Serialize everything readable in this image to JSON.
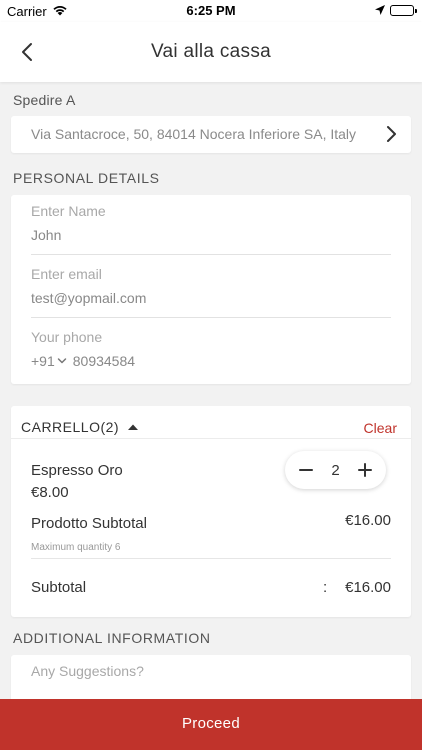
{
  "status_bar": {
    "carrier": "Carrier",
    "time": "6:25 PM",
    "icons": [
      "wifi-icon",
      "location-arrow-icon",
      "battery-icon"
    ]
  },
  "nav": {
    "title": "Vai alla cassa",
    "back_icon": "chevron-left-icon"
  },
  "shipping": {
    "label": "Spedire A",
    "address": "Via Santacroce, 50, 84014 Nocera Inferiore SA, Italy",
    "chevron_icon": "chevron-right-icon"
  },
  "personal": {
    "label": "PERSONAL DETAILS",
    "name": {
      "placeholder": "Enter Name",
      "value": "John"
    },
    "email": {
      "placeholder": "Enter email",
      "value": "test@yopmail.com"
    },
    "phone": {
      "placeholder": "Your phone",
      "country_code": "+91",
      "number": "80934584"
    }
  },
  "cart": {
    "title": "CARRELLO(2)",
    "clear_label": "Clear",
    "item": {
      "name": "Espresso Oro",
      "price": "€8.00",
      "quantity": "2"
    },
    "product_subtotal_label": "Prodotto Subtotal",
    "product_subtotal_value": "€16.00",
    "max_quantity_note": "Maximum quantity 6",
    "subtotal_label": "Subtotal",
    "subtotal_separator": ":",
    "subtotal_value": "€16.00"
  },
  "additional": {
    "label": "ADDITIONAL INFORMATION",
    "suggestions_placeholder": "Any Suggestions?"
  },
  "proceed_label": "Proceed",
  "colors": {
    "accent": "#c0332b",
    "background": "#f2f2f2",
    "card": "#ffffff"
  }
}
